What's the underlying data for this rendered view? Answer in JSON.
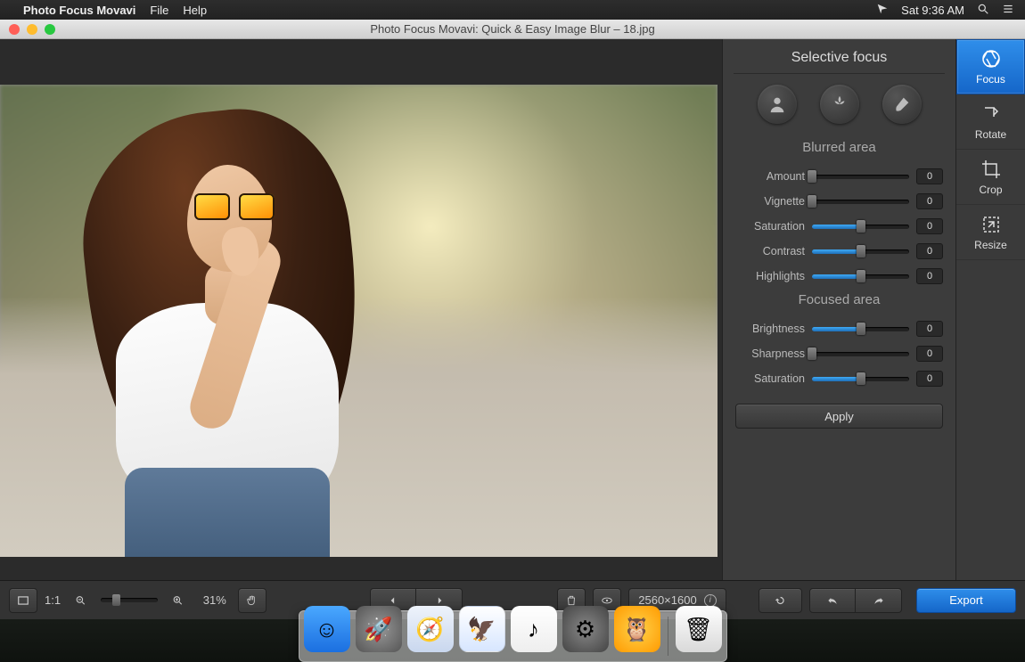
{
  "menubar": {
    "appname": "Photo Focus Movavi",
    "items": [
      "File",
      "Help"
    ],
    "clock": "Sat 9:36 AM"
  },
  "window": {
    "title": "Photo Focus Movavi: Quick & Easy Image Blur – 18.jpg"
  },
  "panel": {
    "title": "Selective focus",
    "modes": [
      {
        "name": "portrait",
        "icon": "person"
      },
      {
        "name": "macro",
        "icon": "flower"
      },
      {
        "name": "custom",
        "icon": "brush"
      }
    ],
    "blurred_title": "Blurred area",
    "blurred_sliders": [
      {
        "label": "Amount",
        "value": 0,
        "blue": false,
        "thumb": 0
      },
      {
        "label": "Vignette",
        "value": 0,
        "blue": false,
        "thumb": 0
      },
      {
        "label": "Saturation",
        "value": 0,
        "blue": true,
        "thumb": 50
      },
      {
        "label": "Contrast",
        "value": 0,
        "blue": true,
        "thumb": 50
      },
      {
        "label": "Highlights",
        "value": 0,
        "blue": true,
        "thumb": 50
      }
    ],
    "focused_title": "Focused area",
    "focused_sliders": [
      {
        "label": "Brightness",
        "value": 0,
        "blue": true,
        "thumb": 50
      },
      {
        "label": "Sharpness",
        "value": 0,
        "blue": false,
        "thumb": 0
      },
      {
        "label": "Saturation",
        "value": 0,
        "blue": true,
        "thumb": 50
      }
    ],
    "apply": "Apply"
  },
  "right_toolbar": [
    {
      "name": "Focus",
      "active": true,
      "icon": "aperture"
    },
    {
      "name": "Rotate",
      "active": false,
      "icon": "rotate"
    },
    {
      "name": "Crop",
      "active": false,
      "icon": "crop"
    },
    {
      "name": "Resize",
      "active": false,
      "icon": "resize"
    }
  ],
  "bottombar": {
    "fit_label": "1:1",
    "zoom_pct": "31%",
    "dimensions": "2560×1600",
    "export": "Export"
  },
  "dock": [
    {
      "name": "finder",
      "glyph": "☺"
    },
    {
      "name": "launchpad",
      "glyph": "🚀"
    },
    {
      "name": "safari",
      "glyph": "🧭"
    },
    {
      "name": "mail",
      "glyph": "🦅"
    },
    {
      "name": "music",
      "glyph": "♪"
    },
    {
      "name": "settings",
      "glyph": "⚙"
    },
    {
      "name": "owl",
      "glyph": "🦉"
    },
    {
      "name": "trash",
      "glyph": "🗑"
    }
  ]
}
